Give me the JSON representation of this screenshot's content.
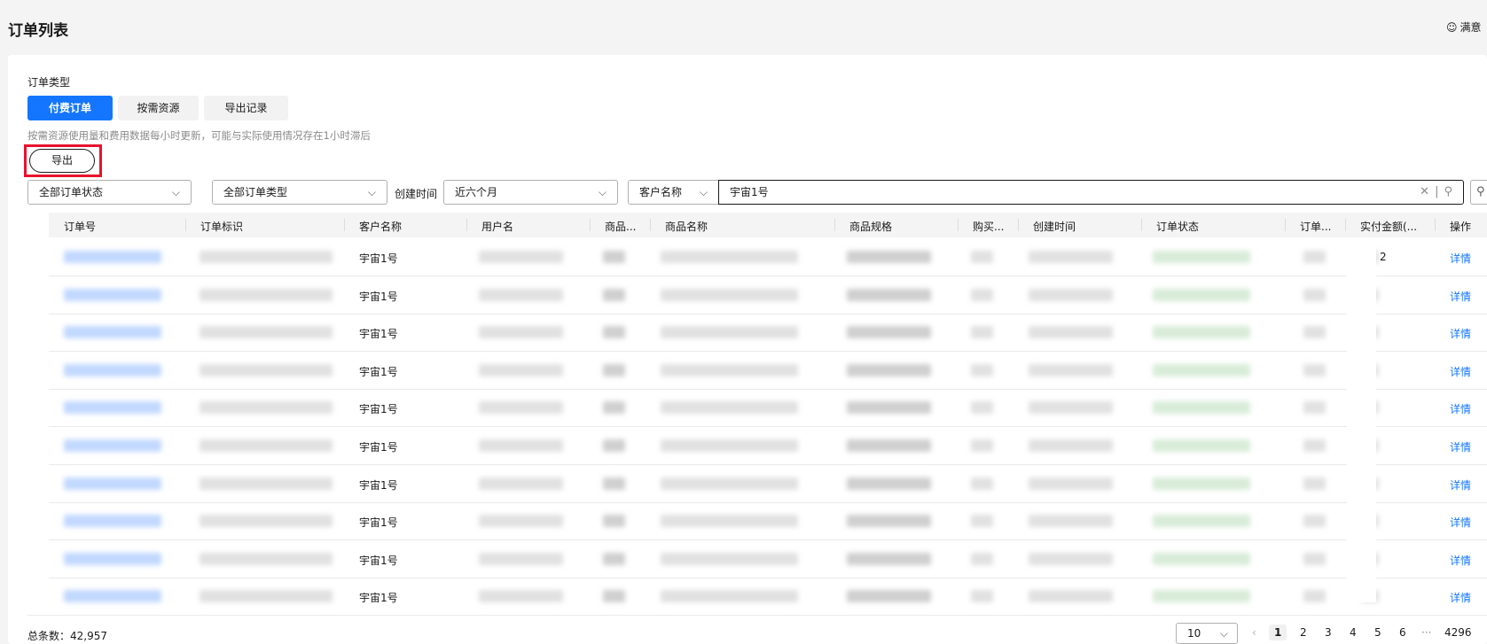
{
  "page": {
    "title": "订单列表",
    "feedback_label": "满意"
  },
  "filters": {
    "order_type_label": "订单类型",
    "tabs": [
      {
        "label": "付费订单",
        "active": true
      },
      {
        "label": "按需资源",
        "active": false
      },
      {
        "label": "导出记录",
        "active": false
      }
    ],
    "note": "按需资源使用量和费用数据每小时更新，可能与实际使用情况存在1小时滞后",
    "export_label": "导出",
    "order_status": "全部订单状态",
    "order_kind": "全部订单类型",
    "created_label": "创建时间",
    "created_range": "近六个月",
    "search_field": "客户名称",
    "search_value": "宇宙1号"
  },
  "table": {
    "headers": [
      "订单号",
      "订单标识",
      "客户名称",
      "用户名",
      "商品...",
      "商品名称",
      "商品规格",
      "购买...",
      "创建时间",
      "订单状态",
      "订单...",
      "实付金额(...",
      "操作"
    ],
    "rows": [
      {
        "customer": "宇宙1号",
        "amount_tail": "2",
        "action": "详情"
      },
      {
        "customer": "宇宙1号",
        "amount_tail": "",
        "action": "详情"
      },
      {
        "customer": "宇宙1号",
        "amount_tail": "",
        "action": "详情"
      },
      {
        "customer": "宇宙1号",
        "amount_tail": "",
        "action": "详情"
      },
      {
        "customer": "宇宙1号",
        "amount_tail": "",
        "action": "详情"
      },
      {
        "customer": "宇宙1号",
        "amount_tail": "",
        "action": "详情"
      },
      {
        "customer": "宇宙1号",
        "amount_tail": "",
        "action": "详情"
      },
      {
        "customer": "宇宙1号",
        "amount_tail": "",
        "action": "详情"
      },
      {
        "customer": "宇宙1号",
        "amount_tail": "",
        "action": "详情"
      },
      {
        "customer": "宇宙1号",
        "amount_tail": "",
        "action": "详情"
      }
    ]
  },
  "footer": {
    "total": "总条数：42,957",
    "page_size": "10",
    "pages": [
      "1",
      "2",
      "3",
      "4",
      "5",
      "6",
      "···",
      "4296"
    ]
  },
  "colors": {
    "primary": "#1476ff",
    "highlight": "#e8112d"
  }
}
